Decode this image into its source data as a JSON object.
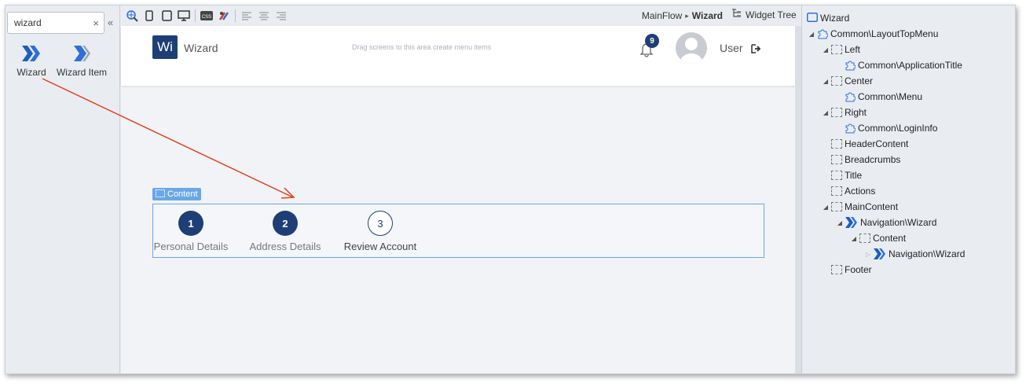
{
  "toolbox": {
    "search_value": "wizard",
    "clear_symbol": "×",
    "collapse_symbol": "«",
    "items": [
      {
        "label": "Wizard",
        "icon": "wizard-icon"
      },
      {
        "label": "Wizard Item",
        "icon": "wizard-item-icon"
      }
    ]
  },
  "toolbar": {
    "breadcrumb_parent": "MainFlow",
    "breadcrumb_separator": "▸",
    "breadcrumb_current": "Wizard",
    "widget_tree_tab": "Widget Tree"
  },
  "page": {
    "logo_text": "Wi",
    "app_title": "Wizard",
    "drag_hint": "Drag screens to this area create menu items",
    "notification_count": "9",
    "user_name": "User",
    "content_tag": "Content"
  },
  "wizard": {
    "steps": [
      {
        "number": "1",
        "label": "Personal Details",
        "state": "done"
      },
      {
        "number": "2",
        "label": "Address Details",
        "state": "done"
      },
      {
        "number": "3",
        "label": "Review Account",
        "state": "todo"
      }
    ]
  },
  "tree": {
    "root": "Wizard",
    "nodes": [
      {
        "label": "Common\\LayoutTopMenu",
        "icon": "puzzle-icon"
      },
      {
        "label": "Left",
        "icon": "placeholder-icon"
      },
      {
        "label": "Common\\ApplicationTitle",
        "icon": "puzzle-icon"
      },
      {
        "label": "Center",
        "icon": "placeholder-icon"
      },
      {
        "label": "Common\\Menu",
        "icon": "puzzle-icon"
      },
      {
        "label": "Right",
        "icon": "placeholder-icon"
      },
      {
        "label": "Common\\LoginInfo",
        "icon": "puzzle-icon"
      },
      {
        "label": "HeaderContent",
        "icon": "placeholder-icon"
      },
      {
        "label": "Breadcrumbs",
        "icon": "placeholder-icon"
      },
      {
        "label": "Title",
        "icon": "placeholder-icon"
      },
      {
        "label": "Actions",
        "icon": "placeholder-icon"
      },
      {
        "label": "MainContent",
        "icon": "placeholder-icon"
      },
      {
        "label": "Navigation\\Wizard",
        "icon": "wizard-icon"
      },
      {
        "label": "Content",
        "icon": "placeholder-icon"
      },
      {
        "label": "Navigation\\Wizard",
        "icon": "wizard-icon"
      },
      {
        "label": "Footer",
        "icon": "placeholder-icon"
      }
    ]
  },
  "colors": {
    "brand": "#1e3f75",
    "accent_blue": "#2f6fd6",
    "content_highlight": "#6aa7e8",
    "annotation_arrow": "#e0401f"
  }
}
